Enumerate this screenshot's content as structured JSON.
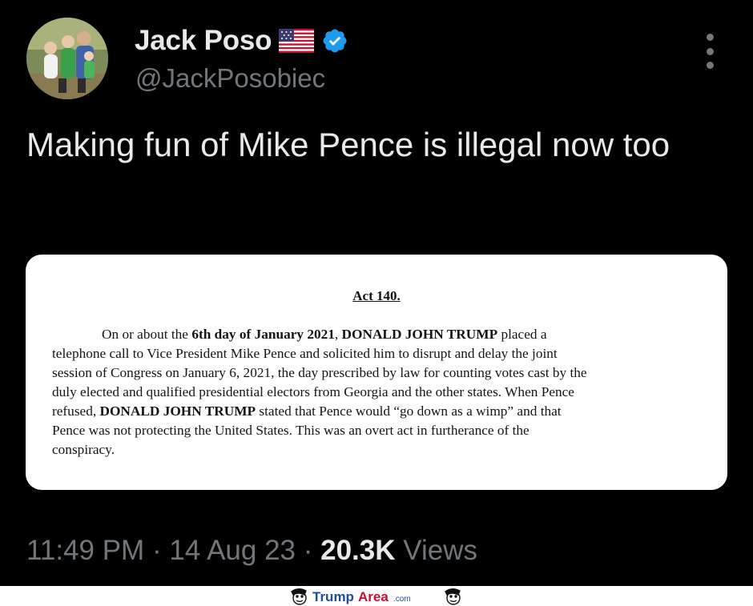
{
  "author": {
    "display_name": "Jack Poso",
    "handle": "@JackPosobiec",
    "flag_icon": "us-flag-emoji",
    "verified_icon": "verified-badge",
    "verified_color": "#1d9bf0"
  },
  "tweet": {
    "text": "Making fun of Mike Pence is illegal now too"
  },
  "document": {
    "heading": "Act 140.",
    "line1_pre": "On or about the ",
    "line1_bold1": "6th day of January 2021",
    "line1_mid": ", ",
    "line1_bold2": "DONALD JOHN TRUMP",
    "line1_post": " placed a",
    "line2": "telephone call to Vice President Mike Pence and solicited him to disrupt and delay the joint",
    "line3": "session of Congress on January 6, 2021, the day prescribed by law for counting votes cast by the",
    "line4": "duly elected and qualified presidential electors from Georgia and the other states. When Pence",
    "line5_pre": "refused, ",
    "line5_bold": "DONALD JOHN TRUMP",
    "line5_post": " stated that Pence would “go down as a wimp” and that",
    "line6": "Pence was not protecting the United States. This was an overt act in furtherance of the",
    "line7": "conspiracy."
  },
  "meta": {
    "time": "11:49 PM",
    "separator": "·",
    "date": "14 Aug 23",
    "views_count": "20.3K",
    "views_label": "Views"
  },
  "watermark": {
    "brand_trump": "Trump",
    "brand_area": "Area",
    "brand_suffix": ".com",
    "trump_color": "#1f4e9c",
    "area_color": "#c8102e"
  },
  "colors": {
    "background": "#000000",
    "primary_text": "#e7e9ea",
    "secondary_text": "#71767b",
    "accent": "#1d9bf0"
  }
}
